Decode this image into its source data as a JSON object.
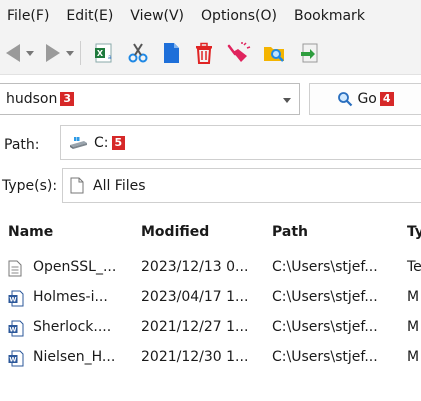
{
  "menu": [
    "File(F)",
    "Edit(E)",
    "View(V)",
    "Options(O)",
    "Bookmark"
  ],
  "toolbar": {
    "icons": [
      "back-arrow-icon",
      "forward-arrow-icon",
      "excel-icon",
      "scissors-icon",
      "document-icon",
      "trash-icon",
      "broom-icon",
      "folder-search-icon",
      "import-icon"
    ]
  },
  "search": {
    "value": "hudson",
    "badge": "3",
    "go_label": "Go",
    "go_badge": "4"
  },
  "path": {
    "label": "Path:",
    "value": "C:",
    "badge": "5"
  },
  "types": {
    "label": "Type(s):",
    "value": "All Files"
  },
  "table": {
    "columns": [
      "Name",
      "Modified",
      "Path",
      "Ty"
    ],
    "rows": [
      {
        "icon": "text-file-icon",
        "name": "OpenSSL_...",
        "modified": "2023/12/13 0...",
        "path": "C:\\Users\\stjef...",
        "type": "Te"
      },
      {
        "icon": "word-doc-icon",
        "name": "Holmes-i...",
        "modified": "2023/04/17 1...",
        "path": "C:\\Users\\stjef...",
        "type": "M"
      },
      {
        "icon": "word-doc-icon",
        "name": "Sherlock....",
        "modified": "2021/12/27 1...",
        "path": "C:\\Users\\stjef...",
        "type": "M"
      },
      {
        "icon": "word-doc-icon",
        "name": "Nielsen_H...",
        "modified": "2021/12/30 1...",
        "path": "C:\\Users\\stjef...",
        "type": "M"
      }
    ]
  }
}
